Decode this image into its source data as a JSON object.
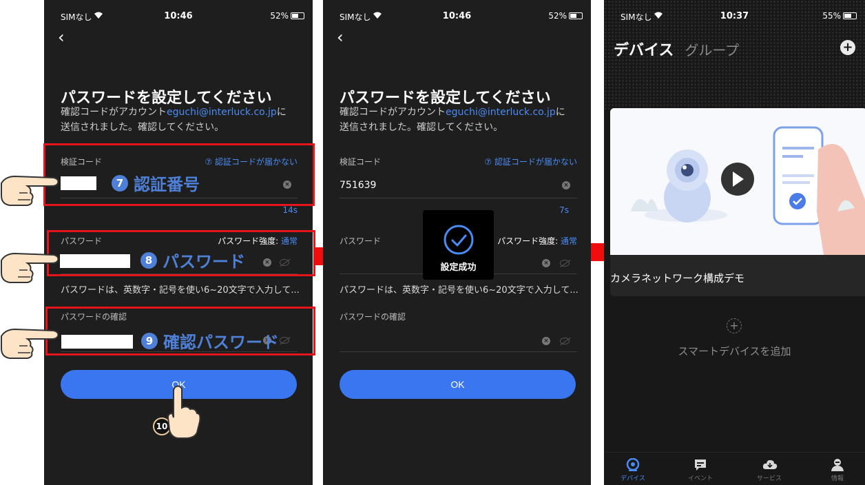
{
  "screen1": {
    "status": {
      "carrier": "SIMなし",
      "time": "10:46",
      "battery": "52%"
    },
    "title": "パスワードを設定してください",
    "desc_prefix": "確認コードがアカウント",
    "email": "eguchi@interluck.co.jp",
    "desc_suffix": "に",
    "desc_line2": "送信されました。確認してください。",
    "code_label": "検証コード",
    "code_link": "認証コードが届かない",
    "timer": "14s",
    "password_label": "パスワード",
    "strength_label": "パスワード強度:",
    "strength_value": "通常",
    "hint": "パスワードは、英数字・記号を使い6~20文字で入力して...",
    "confirm_label": "パスワードの確認",
    "ok_label": "OK"
  },
  "annotations": {
    "step7_num": "7",
    "step7": "認証番号",
    "step8_num": "8",
    "step8": "パスワード",
    "step9_num": "9",
    "step9": "確認パスワード",
    "step10_num": "10"
  },
  "screen2": {
    "status": {
      "carrier": "SIMなし",
      "time": "10:46",
      "battery": "52%"
    },
    "title": "パスワードを設定してください",
    "desc_prefix": "確認コードがアカウント",
    "email": "eguchi@interluck.co.jp",
    "desc_suffix": "に",
    "desc_line2": "送信されました。確認してください。",
    "code_label": "検証コード",
    "code_link": "認証コードが届かない",
    "code_value": "751639",
    "timer": "7s",
    "password_label": "パスワード",
    "strength_label": "パスワード強度:",
    "strength_value": "通常",
    "hint": "パスワードは、英数字・記号を使い6~20文字で入力して...",
    "confirm_label": "パスワードの確認",
    "ok_label": "OK",
    "toast": "設定成功"
  },
  "screen3": {
    "status": {
      "carrier": "SIMなし",
      "time": "10:37",
      "battery": "55%"
    },
    "tab_devices": "デバイス",
    "tab_groups": "グループ",
    "card_title": "カメラネットワーク構成デモ",
    "add_label": "スマートデバイスを追加",
    "nav": [
      "デバイス",
      "イベント",
      "サービス",
      "情報"
    ]
  },
  "colors": {
    "accent": "#3a76f0",
    "highlight": "#e8141b",
    "annotation": "#4f80d8"
  }
}
